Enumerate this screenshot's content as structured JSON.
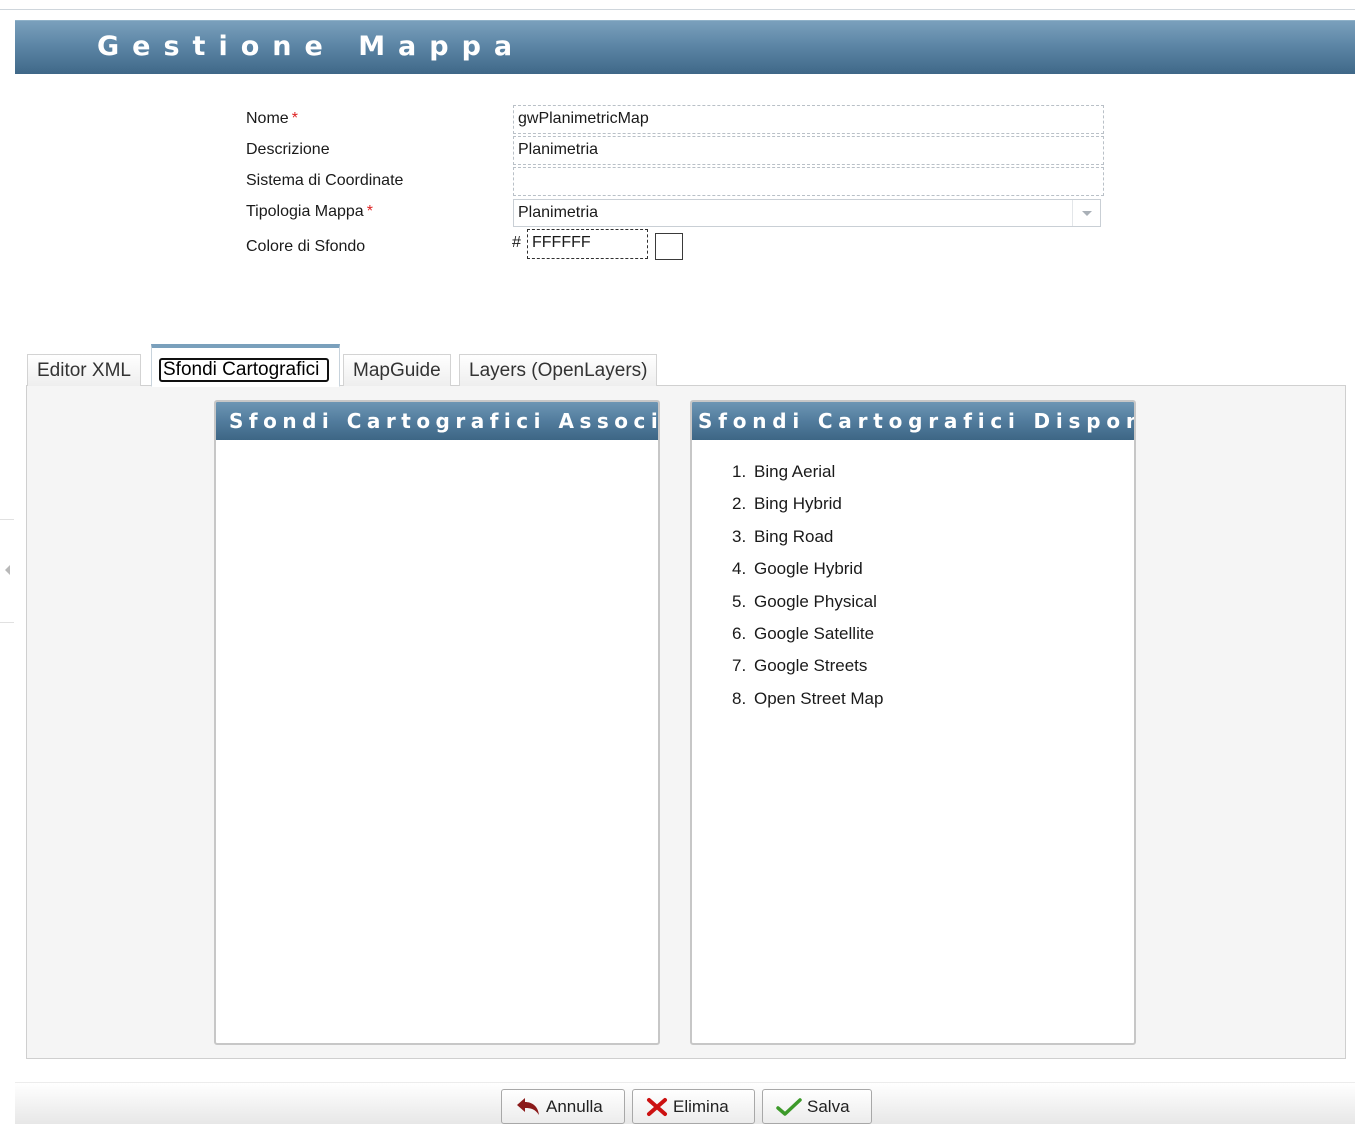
{
  "header": {
    "title": "Gestione Mappa"
  },
  "form": {
    "nome": {
      "label": "Nome",
      "required": "*",
      "value": "gwPlanimetricMap"
    },
    "descrizione": {
      "label": "Descrizione",
      "value": "Planimetria"
    },
    "sistema": {
      "label": "Sistema di Coordinate",
      "value": ""
    },
    "tipologia": {
      "label": "Tipologia Mappa",
      "required": "*",
      "value": "Planimetria"
    },
    "colore": {
      "label": "Colore di Sfondo",
      "prefix": "#",
      "value": "FFFFFF",
      "swatch": "#FFFFFF"
    }
  },
  "tabs": [
    {
      "label": "Editor XML"
    },
    {
      "label": "Sfondi Cartografici"
    },
    {
      "label": "MapGuide"
    },
    {
      "label": "Layers (OpenLayers)"
    }
  ],
  "panels": {
    "associati": {
      "title": "Sfondi Cartografici Associati"
    },
    "disponibili": {
      "title": "Sfondi Cartografici Disponib..",
      "items": [
        {
          "num": "1.",
          "label": "Bing Aerial"
        },
        {
          "num": "2.",
          "label": "Bing Hybrid"
        },
        {
          "num": "3.",
          "label": "Bing Road"
        },
        {
          "num": "4.",
          "label": "Google Hybrid"
        },
        {
          "num": "5.",
          "label": "Google Physical"
        },
        {
          "num": "6.",
          "label": "Google Satellite"
        },
        {
          "num": "7.",
          "label": "Google Streets"
        },
        {
          "num": "8.",
          "label": "Open Street Map"
        }
      ]
    }
  },
  "buttons": {
    "annulla": "Annulla",
    "elimina": "Elimina",
    "salva": "Salva"
  },
  "colors": {
    "header": "#5d86a6",
    "required": "#dd2222",
    "annulla_icon": "#8b1a1a",
    "elimina_icon": "#cc1111",
    "salva_icon": "#3d9a2a"
  }
}
